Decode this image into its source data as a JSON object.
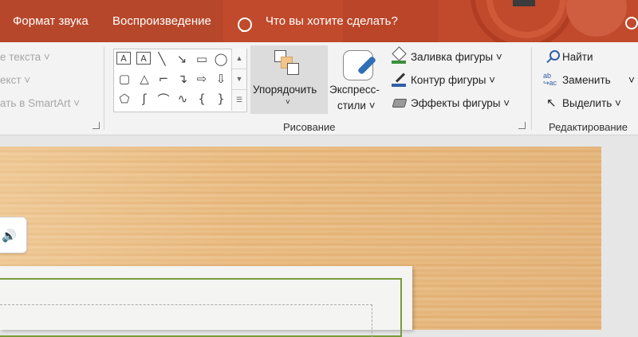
{
  "tabs": {
    "format_audio": "Формат звука",
    "playback": "Воспроизведение",
    "tell_me": "Что вы хотите сделать?"
  },
  "paragraph_group": {
    "text_direction": "е текста",
    "align_text": "екст",
    "convert_smartart": "ать в SmartArt"
  },
  "drawing_group": {
    "label": "Рисование",
    "arrange": "Упорядочить",
    "quick_styles_line1": "Экспресс-",
    "quick_styles_line2": "стили",
    "shape_fill": "Заливка фигуры",
    "shape_outline": "Контур фигуры",
    "shape_effects": "Эффекты фигуры"
  },
  "editing_group": {
    "label": "Редактирование",
    "find": "Найти",
    "replace": "Заменить",
    "select": "Выделить"
  },
  "colors": {
    "accent": "#b7472a",
    "fill_bar": "#3b8f3b",
    "outline_bar": "#2e5fa8"
  }
}
